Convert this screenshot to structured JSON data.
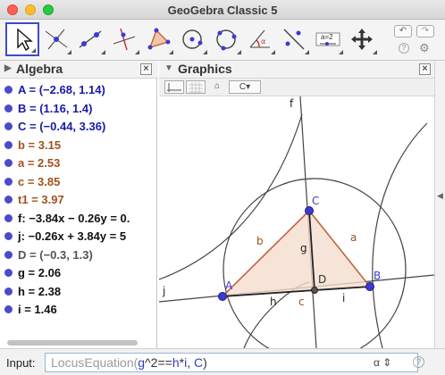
{
  "window": {
    "title": "GeoGebra Classic 5"
  },
  "toolbar": {
    "tools": [
      {
        "name": "move-tool-icon"
      },
      {
        "name": "point-on-object-tool-icon"
      },
      {
        "name": "line-tool-icon"
      },
      {
        "name": "perpendicular-line-tool-icon"
      },
      {
        "name": "polygon-tool-icon"
      },
      {
        "name": "circle-center-point-tool-icon"
      },
      {
        "name": "circle-three-points-tool-icon"
      },
      {
        "name": "angle-tool-icon"
      },
      {
        "name": "reflect-tool-icon"
      },
      {
        "name": "slider-tool-icon"
      },
      {
        "name": "move-graphics-view-tool-icon"
      }
    ],
    "slider_text": "a=2"
  },
  "algebra": {
    "title": "Algebra",
    "items": [
      {
        "text": "A = (−2.68, 1.14)",
        "color": "#1a1aa6",
        "dot": "#4b4bc9"
      },
      {
        "text": "B = (1.16, 1.4)",
        "color": "#1a1aa6",
        "dot": "#4b4bc9"
      },
      {
        "text": "C = (−0.44, 3.36)",
        "color": "#1a1aa6",
        "dot": "#4b4bc9"
      },
      {
        "text": "b = 3.15",
        "color": "#a0521b",
        "dot": "#4b4bc9"
      },
      {
        "text": "a = 2.53",
        "color": "#a0521b",
        "dot": "#4b4bc9"
      },
      {
        "text": "c = 3.85",
        "color": "#a0521b",
        "dot": "#4b4bc9"
      },
      {
        "text": "t1 = 3.97",
        "color": "#a0521b",
        "dot": "#4b4bc9"
      },
      {
        "text": "f: −3.84x − 0.26y = 0.",
        "color": "#111111",
        "dot": "#4b4bc9"
      },
      {
        "text": "j: −0.26x + 3.84y = 5",
        "color": "#111111",
        "dot": "#4b4bc9"
      },
      {
        "text": "D = (−0.3, 1.3)",
        "color": "#555555",
        "dot": "#4b4bc9"
      },
      {
        "text": "g = 2.06",
        "color": "#111111",
        "dot": "#4b4bc9"
      },
      {
        "text": "h = 2.38",
        "color": "#111111",
        "dot": "#4b4bc9"
      },
      {
        "text": "i = 1.46",
        "color": "#111111",
        "dot": "#4b4bc9"
      }
    ]
  },
  "graphics": {
    "title": "Graphics",
    "style_buttons": [
      "axes-toggle-icon",
      "grid-toggle-icon",
      "home-icon",
      "style-dropdown-icon"
    ],
    "labels": {
      "f": "f",
      "j": "j",
      "C": "C",
      "A": "A",
      "B": "B",
      "D": "D",
      "a": "a",
      "b": "b",
      "c": "c",
      "g": "g",
      "h": "h",
      "i": "i"
    }
  },
  "input": {
    "label": "Input:",
    "parts": [
      {
        "text": "LocusEquation(",
        "color": "#9a9a9a"
      },
      {
        "text": "g",
        "color": "#2f3fc6"
      },
      {
        "text": "^2==",
        "color": "#333333"
      },
      {
        "text": "h",
        "color": "#2f3fc6"
      },
      {
        "text": "*",
        "color": "#333333"
      },
      {
        "text": "i",
        "color": "#2f3fc6"
      },
      {
        "text": ", ",
        "color": "#333333"
      },
      {
        "text": "C",
        "color": "#2f3fc6"
      },
      {
        "text": ")",
        "color": "#333333"
      }
    ],
    "alpha": "α",
    "help": "?"
  },
  "colors": {
    "triangle": "#c0643c",
    "point": "#3a3ad4",
    "grey_point": "#555555"
  }
}
